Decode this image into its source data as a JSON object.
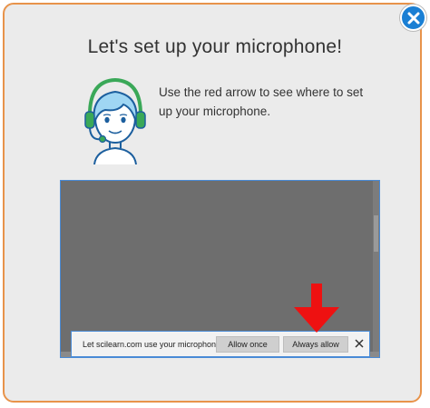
{
  "dialog": {
    "title": "Let's set up your microphone!",
    "instruction": "Use the red arrow to see where to set up your microphone.",
    "close_icon": "close-icon",
    "accent_border": "#e8934a",
    "close_color": "#1a7fd4"
  },
  "notification": {
    "message": "Let scilearn.com use your microphone?",
    "allow_once_label": "Allow once",
    "always_allow_label": "Always allow",
    "close_icon": "x-icon"
  },
  "pointer": {
    "icon": "red-arrow-down-icon",
    "color": "#ee1111"
  }
}
